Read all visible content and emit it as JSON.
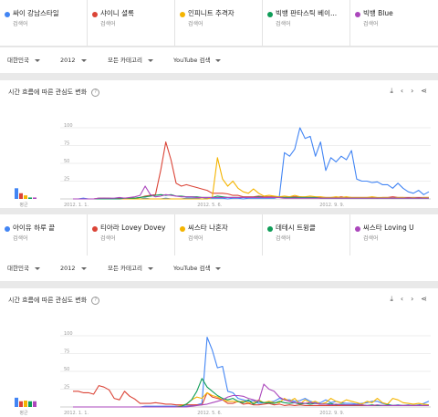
{
  "set1": {
    "terms": [
      {
        "name": "싸이 강남스타일",
        "sub": "검색어",
        "color": "#4285f4"
      },
      {
        "name": "샤이니 셜록",
        "sub": "검색어",
        "color": "#db4437"
      },
      {
        "name": "인피니트 추격자",
        "sub": "검색어",
        "color": "#f4b400"
      },
      {
        "name": "빅뱅 판타스틱 베이...",
        "sub": "검색어",
        "color": "#0f9d58"
      },
      {
        "name": "빅뱅 Blue",
        "sub": "검색어",
        "color": "#ab47bc"
      }
    ],
    "filters": {
      "region": "대한민국",
      "year": "2012",
      "category": "모든 카테고리",
      "source": "YouTube 검색"
    },
    "card_title": "시간 흐름에 따른 관심도 변화",
    "help": "?",
    "icons": [
      "download-icon",
      "embed-icon",
      "share-icon"
    ],
    "icon_glyphs": {
      "download": "⤓",
      "embed": "‹›",
      "share": "⋖"
    },
    "avg_label": "평균",
    "chart_data": {
      "type": "line",
      "yticks": [
        25,
        50,
        75,
        100
      ],
      "xticks": [
        "2012. 1. 1.",
        "2012. 5. 6.",
        "2012. 9. 9."
      ],
      "ylim": [
        0,
        100
      ],
      "averages": [
        15,
        8,
        5,
        2,
        2
      ],
      "series": [
        {
          "color": "#4285f4",
          "values": [
            0,
            0,
            1,
            0,
            0,
            0,
            1,
            0,
            0,
            0,
            1,
            0,
            0,
            0,
            1,
            0,
            0,
            0,
            1,
            0,
            0,
            0,
            1,
            1,
            1,
            0,
            1,
            1,
            1,
            1,
            0,
            1,
            1,
            0,
            1,
            1,
            1,
            1,
            1,
            1,
            3,
            65,
            60,
            70,
            100,
            85,
            88,
            60,
            80,
            40,
            58,
            52,
            60,
            55,
            68,
            28,
            25,
            25,
            23,
            24,
            20,
            20,
            15,
            22,
            15,
            10,
            8,
            12,
            6,
            10
          ]
        },
        {
          "color": "#db4437",
          "values": [
            0,
            0,
            0,
            0,
            0,
            1,
            1,
            1,
            0,
            1,
            1,
            1,
            1,
            2,
            4,
            5,
            6,
            40,
            80,
            55,
            22,
            18,
            20,
            18,
            16,
            14,
            12,
            8,
            8,
            8,
            7,
            5,
            5,
            3,
            3,
            3,
            4,
            3,
            3,
            3,
            3,
            2,
            3,
            3,
            3,
            2,
            2,
            2,
            2,
            2,
            2,
            2,
            3,
            2,
            2,
            2,
            2,
            2,
            2,
            1,
            2,
            2,
            3,
            2,
            2,
            2,
            2,
            2,
            2,
            2
          ]
        },
        {
          "color": "#f4b400",
          "values": [
            0,
            0,
            0,
            0,
            0,
            0,
            0,
            0,
            0,
            0,
            0,
            0,
            0,
            0,
            0,
            0,
            0,
            0,
            0,
            0,
            0,
            0,
            0,
            0,
            0,
            0,
            0,
            2,
            58,
            28,
            18,
            25,
            15,
            10,
            8,
            14,
            8,
            4,
            5,
            4,
            3,
            4,
            3,
            5,
            3,
            3,
            4,
            3,
            3,
            2,
            2,
            3,
            2,
            3,
            2,
            2,
            2,
            2,
            3,
            2,
            2,
            2,
            1,
            2,
            2,
            1,
            2,
            1,
            2,
            2
          ]
        },
        {
          "color": "#0f9d58",
          "values": [
            0,
            0,
            0,
            0,
            0,
            0,
            0,
            0,
            0,
            0,
            1,
            1,
            1,
            2,
            3,
            4,
            5,
            6,
            5,
            6,
            4,
            4,
            3,
            3,
            3,
            2,
            2,
            2,
            4,
            3,
            2,
            2,
            2,
            2,
            2,
            2,
            3,
            2,
            2,
            2,
            2,
            2,
            2,
            2,
            2,
            2,
            2,
            2,
            1,
            1,
            1,
            1,
            1,
            1,
            1,
            1,
            1,
            1,
            1,
            1,
            1,
            1,
            1,
            1,
            1,
            1,
            1,
            1,
            1,
            1
          ]
        },
        {
          "color": "#ab47bc",
          "values": [
            0,
            0,
            0,
            0,
            0,
            1,
            1,
            1,
            1,
            2,
            1,
            2,
            3,
            5,
            18,
            6,
            3,
            4,
            6,
            5,
            4,
            3,
            3,
            3,
            2,
            2,
            2,
            2,
            2,
            2,
            2,
            2,
            2,
            2,
            2,
            2,
            2,
            2,
            2,
            2,
            2,
            1,
            1,
            1,
            1,
            1,
            1,
            1,
            1,
            1,
            1,
            1,
            1,
            1,
            1,
            1,
            1,
            1,
            1,
            1,
            1,
            1,
            1,
            1,
            1,
            1,
            1,
            1,
            1,
            1
          ]
        }
      ]
    }
  },
  "set2": {
    "terms": [
      {
        "name": "아이유 하루 끝",
        "sub": "검색어",
        "color": "#4285f4"
      },
      {
        "name": "티아라 Lovey Dovey",
        "sub": "검색어",
        "color": "#db4437"
      },
      {
        "name": "씨스타 나혼자",
        "sub": "검색어",
        "color": "#f4b400"
      },
      {
        "name": "데테시 트윙클",
        "sub": "검색어",
        "color": "#0f9d58"
      },
      {
        "name": "씨스타 Loving U",
        "sub": "검색어",
        "color": "#ab47bc"
      }
    ],
    "filters": {
      "region": "대한민국",
      "year": "2012",
      "category": "모든 카테고리",
      "source": "YouTube 검색"
    },
    "card_title": "시간 흐름에 따른 관심도 변화",
    "help": "?",
    "icons": [
      "download-icon",
      "embed-icon",
      "share-icon"
    ],
    "icon_glyphs": {
      "download": "⤓",
      "embed": "‹›",
      "share": "⋖"
    },
    "avg_label": "평균",
    "chart_data": {
      "type": "line",
      "yticks": [
        25,
        50,
        75,
        100
      ],
      "xticks": [
        "2012. 1. 1.",
        "2012. 5. 6.",
        "2012. 9. 9."
      ],
      "ylim": [
        0,
        100
      ],
      "averages": [
        13,
        8,
        9,
        8,
        8
      ],
      "series": [
        {
          "color": "#4285f4",
          "values": [
            0,
            0,
            0,
            0,
            0,
            0,
            0,
            0,
            0,
            0,
            0,
            0,
            0,
            0,
            1,
            1,
            1,
            1,
            1,
            1,
            1,
            1,
            1,
            2,
            3,
            5,
            98,
            80,
            55,
            57,
            22,
            20,
            12,
            10,
            8,
            9,
            5,
            6,
            7,
            8,
            12,
            10,
            10,
            8,
            9,
            12,
            8,
            6,
            6,
            10,
            6,
            8,
            6,
            5,
            5,
            4,
            5,
            6,
            8,
            8,
            5,
            4,
            2,
            3,
            2,
            3,
            2,
            3,
            5,
            8
          ]
        },
        {
          "color": "#db4437",
          "values": [
            22,
            22,
            20,
            20,
            18,
            30,
            28,
            24,
            12,
            10,
            22,
            15,
            11,
            5,
            5,
            5,
            6,
            5,
            4,
            4,
            3,
            3,
            3,
            3,
            3,
            3,
            20,
            14,
            12,
            10,
            5,
            5,
            8,
            4,
            5,
            3,
            3,
            4,
            5,
            3,
            4,
            2,
            3,
            2,
            3,
            2,
            2,
            2,
            2,
            2,
            2,
            2,
            2,
            2,
            2,
            2,
            2,
            2,
            2,
            2,
            2,
            2,
            2,
            2,
            2,
            2,
            2,
            2,
            2,
            2
          ]
        },
        {
          "color": "#f4b400",
          "values": [
            0,
            0,
            0,
            0,
            0,
            0,
            0,
            0,
            0,
            0,
            0,
            0,
            0,
            0,
            0,
            0,
            0,
            0,
            0,
            0,
            0,
            2,
            4,
            10,
            14,
            12,
            20,
            16,
            14,
            10,
            8,
            8,
            7,
            8,
            6,
            6,
            10,
            6,
            8,
            6,
            6,
            12,
            8,
            12,
            4,
            10,
            6,
            8,
            4,
            6,
            12,
            8,
            6,
            10,
            8,
            6,
            4,
            8,
            6,
            12,
            6,
            4,
            12,
            10,
            6,
            5,
            4,
            5,
            4,
            3
          ]
        },
        {
          "color": "#0f9d58",
          "values": [
            0,
            0,
            0,
            0,
            0,
            0,
            0,
            0,
            0,
            0,
            0,
            0,
            0,
            0,
            0,
            0,
            0,
            0,
            0,
            0,
            0,
            1,
            4,
            10,
            22,
            40,
            28,
            22,
            16,
            12,
            10,
            12,
            8,
            6,
            10,
            4,
            8,
            6,
            6,
            5,
            8,
            6,
            5,
            6,
            4,
            5,
            4,
            5,
            4,
            4,
            5,
            3,
            4,
            3,
            3,
            3,
            3,
            2,
            3,
            2,
            2,
            3,
            2,
            2,
            2,
            2,
            2,
            2,
            2,
            2
          ]
        },
        {
          "color": "#ab47bc",
          "values": [
            0,
            0,
            0,
            0,
            0,
            0,
            0,
            0,
            0,
            0,
            0,
            0,
            0,
            0,
            0,
            0,
            0,
            0,
            0,
            0,
            0,
            0,
            0,
            1,
            2,
            3,
            4,
            6,
            8,
            10,
            14,
            16,
            16,
            15,
            12,
            10,
            8,
            32,
            25,
            22,
            14,
            10,
            8,
            6,
            6,
            5,
            6,
            5,
            4,
            4,
            3,
            4,
            3,
            3,
            3,
            3,
            3,
            2,
            2,
            3,
            2,
            2,
            2,
            2,
            2,
            2,
            2,
            2,
            2,
            2
          ]
        }
      ]
    }
  }
}
